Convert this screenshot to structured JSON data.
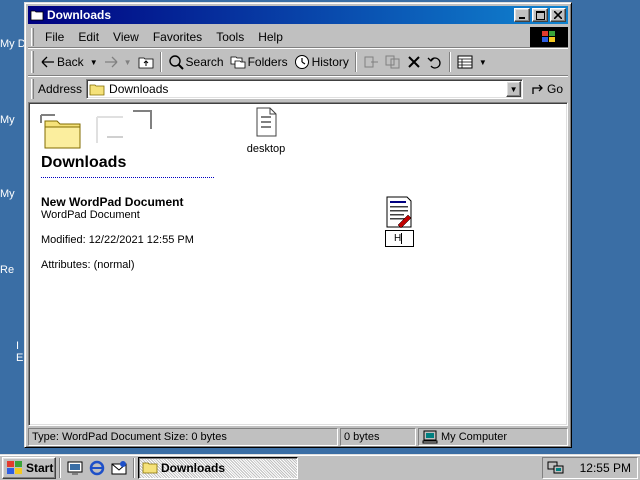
{
  "desktop": {
    "labels": [
      "My D",
      "My",
      "My",
      "Re",
      "I",
      "E"
    ]
  },
  "window": {
    "title": "Downloads",
    "controls": {
      "minimize": "_",
      "maximize": "□",
      "close": "×"
    }
  },
  "menubar": {
    "items": [
      "File",
      "Edit",
      "View",
      "Favorites",
      "Tools",
      "Help"
    ]
  },
  "toolbar": {
    "back_label": "Back",
    "search_label": "Search",
    "folders_label": "Folders",
    "history_label": "History"
  },
  "address": {
    "label": "Address",
    "value": "Downloads",
    "go_label": "Go"
  },
  "content": {
    "folder_heading": "Downloads",
    "desktop_item_label": "desktop",
    "info_title": "New WordPad Document",
    "info_type": "WordPad Document",
    "info_modified": "Modified: 12/22/2021 12:55 PM",
    "info_attributes": "Attributes: (normal)",
    "rename_value": "H"
  },
  "statusbar": {
    "type_size": "Type: WordPad Document Size: 0 bytes",
    "bytes": "0 bytes",
    "zone": "My Computer"
  },
  "taskbar": {
    "start_label": "Start",
    "task_label": "Downloads",
    "clock": "12:55 PM"
  },
  "colors": {
    "desktop": "#3a6ea5",
    "titlebar_start": "#000080",
    "titlebar_end": "#1084d0",
    "face": "#c0c0c0"
  }
}
